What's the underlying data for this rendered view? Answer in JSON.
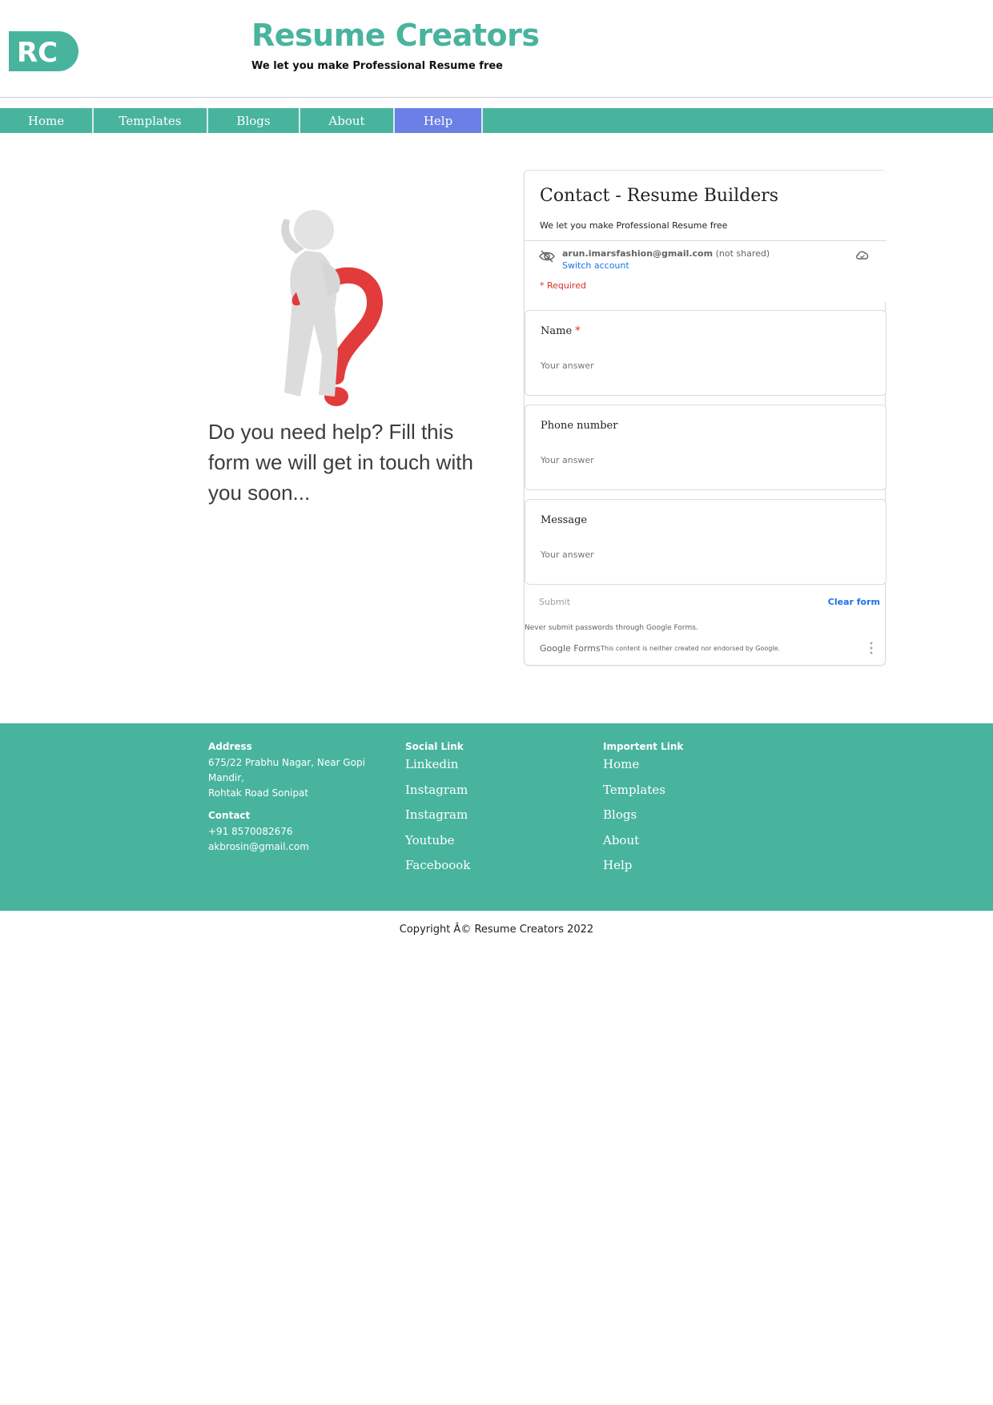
{
  "header": {
    "logo_text": "RC",
    "title": "Resume Creators",
    "tagline": "We let you make Professional Resume free"
  },
  "nav": [
    {
      "label": "Home",
      "active": false
    },
    {
      "label": "Templates",
      "active": false
    },
    {
      "label": "Blogs",
      "active": false
    },
    {
      "label": "About",
      "active": false
    },
    {
      "label": "Help",
      "active": true
    }
  ],
  "help": {
    "text": "Do you need help? Fill this form we will get in touch with you soon..."
  },
  "form": {
    "title": "Contact - Resume Builders",
    "description": "We let you make Professional Resume free",
    "account_email": "arun.imarsfashion@gmail.com",
    "not_shared": "(not shared)",
    "switch_account": "Switch account",
    "required_note": "* Required",
    "questions": [
      {
        "label": "Name",
        "required": true,
        "placeholder": "Your answer"
      },
      {
        "label": "Phone number",
        "required": false,
        "placeholder": "Your answer"
      },
      {
        "label": "Message",
        "required": false,
        "placeholder": "Your answer"
      }
    ],
    "submit_label": "Submit",
    "clear_label": "Clear form",
    "never_note": "Never submit passwords through Google Forms.",
    "gforms_brand": "Google Forms",
    "endorse_note": "This content is neither created nor endorsed by Google."
  },
  "footer": {
    "address_heading": "Address",
    "address_line1": "675/22 Prabhu Nagar, Near Gopi Mandir,",
    "address_line2": "Rohtak Road Sonipat",
    "contact_heading": "Contact",
    "phone": "+91 8570082676",
    "email": "akbrosin@gmail.com",
    "social_heading": "Social Link",
    "social_links": [
      "Linkedin",
      "Instagram",
      "Instagram",
      "Youtube",
      "Faceboook"
    ],
    "important_heading": "Importent Link",
    "important_links": [
      "Home",
      "Templates",
      "Blogs",
      "About",
      "Help"
    ]
  },
  "copyright": "Copyright Â© Resume Creators 2022",
  "colors": {
    "brand": "#48b49d",
    "nav_active": "#6b7fe6",
    "required": "#d93025",
    "link_blue": "#1a73e8"
  }
}
